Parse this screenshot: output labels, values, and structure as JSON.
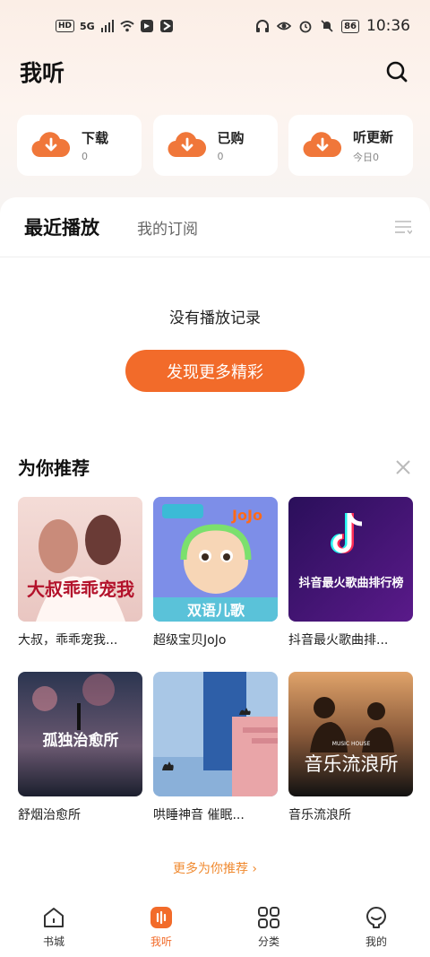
{
  "status_bar": {
    "hd": "HD",
    "network": "5G",
    "battery": "86",
    "time": "10:36"
  },
  "header": {
    "title": "我听"
  },
  "quick_cards": [
    {
      "label": "下载",
      "count": "0"
    },
    {
      "label": "已购",
      "count": "0"
    },
    {
      "label": "听更新",
      "count": "今日0"
    }
  ],
  "tabs": {
    "active": "最近播放",
    "other": "我的订阅"
  },
  "empty_state": {
    "text": "没有播放记录",
    "button": "发现更多精彩"
  },
  "recommend": {
    "title": "为你推荐",
    "items": [
      {
        "title": "大叔，乖乖宠我...",
        "cover_text": "大叔乖乖宠我"
      },
      {
        "title": "超级宝贝JoJo",
        "cover_text": "双语儿歌",
        "badge": "JoJo"
      },
      {
        "title": "抖音最火歌曲排...",
        "cover_text": "抖音最火歌曲排行榜"
      },
      {
        "title": "舒烟治愈所",
        "cover_text": "孤独治愈所"
      },
      {
        "title": "哄睡神音 催眠...",
        "cover_text": ""
      },
      {
        "title": "音乐流浪所",
        "cover_text": "音乐流浪所",
        "badge": "MUSIC HOUSE"
      }
    ],
    "more": "更多为你推荐 ›"
  },
  "bottom_nav": [
    {
      "label": "书城",
      "icon": "home-icon"
    },
    {
      "label": "我听",
      "icon": "listen-icon",
      "active": true
    },
    {
      "label": "分类",
      "icon": "grid-icon"
    },
    {
      "label": "我的",
      "icon": "profile-icon"
    }
  ],
  "colors": {
    "accent": "#f26b2a",
    "link": "#f08a30"
  }
}
